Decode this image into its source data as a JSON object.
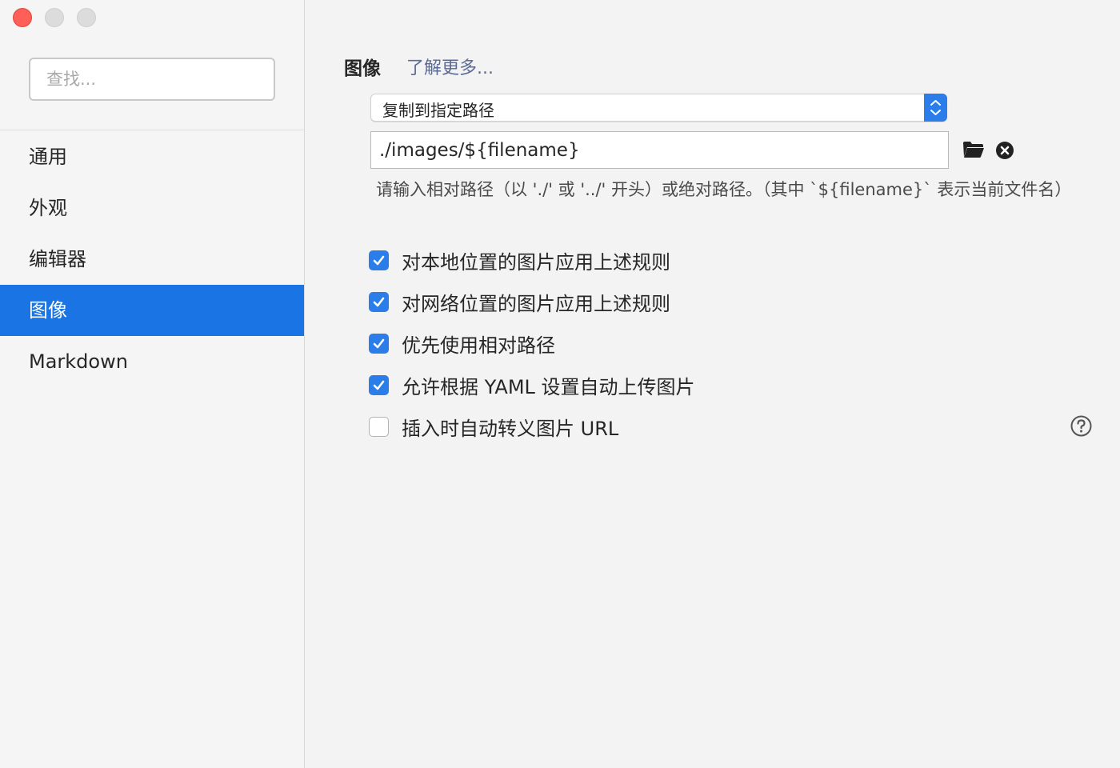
{
  "window": {
    "controls": [
      "close",
      "minimize",
      "zoom"
    ]
  },
  "sidebar": {
    "search_placeholder": "查找...",
    "items": [
      {
        "label": "通用",
        "active": false
      },
      {
        "label": "外观",
        "active": false
      },
      {
        "label": "编辑器",
        "active": false
      },
      {
        "label": "图像",
        "active": true
      },
      {
        "label": "Markdown",
        "active": false
      }
    ],
    "active_color": "#1b74e4"
  },
  "main": {
    "section_title": "图像",
    "learn_more": "了解更多...",
    "action_select": {
      "value": "复制到指定路径",
      "icon": "up-down-chevron-icon"
    },
    "path_field": {
      "value": "./images/${filename}",
      "folder_icon": "folder-icon",
      "clear_icon": "clear-circle-icon"
    },
    "hint": "请输入相对路径（以 './' 或 '../' 开头）或绝对路径。（其中 `${filename}` 表示当前文件名）",
    "options": [
      {
        "label": "对本地位置的图片应用上述规则",
        "checked": true
      },
      {
        "label": "对网络位置的图片应用上述规则",
        "checked": true
      },
      {
        "label": "优先使用相对路径",
        "checked": true
      },
      {
        "label": "允许根据 YAML 设置自动上传图片",
        "checked": true
      },
      {
        "label": "插入时自动转义图片 URL",
        "checked": false
      }
    ],
    "help_icon": "question-circle-icon",
    "accent_color": "#2b7de9"
  }
}
